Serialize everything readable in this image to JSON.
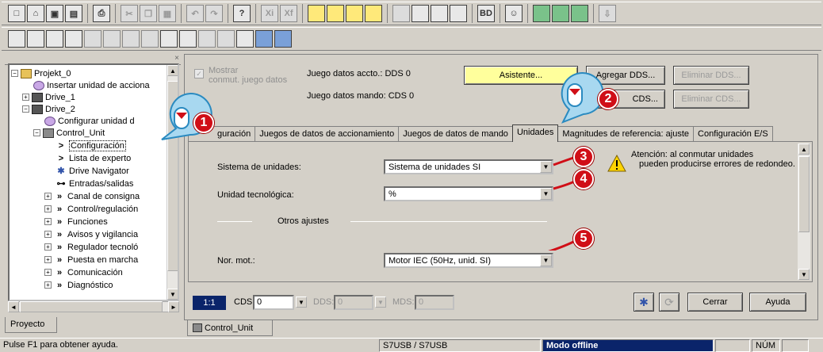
{
  "toolbar1": {
    "groups": [
      [
        "new-icon",
        "open-icon",
        "save-icon",
        "save-all-icon"
      ],
      [
        "print-icon"
      ],
      [
        "cut-icon",
        "copy-icon",
        "paste-icon"
      ],
      [
        "undo-icon",
        "redo-icon"
      ],
      [
        "help-icon"
      ],
      [
        "xi-icon",
        "xf-icon"
      ],
      [
        "view1-icon",
        "view2-icon",
        "view3-icon",
        "view4-icon"
      ],
      [
        "tool1-icon",
        "tool2-icon",
        "tool3-icon",
        "tool4-icon"
      ],
      [
        "bd-icon"
      ],
      [
        "user-icon"
      ],
      [
        "chart1-icon",
        "chart2-icon",
        "chart3-icon"
      ],
      [
        "download-icon"
      ]
    ]
  },
  "toolbar2": {
    "groups": [
      [
        "t1-icon",
        "t2-icon",
        "t3-icon",
        "t4-icon",
        "t5-icon",
        "t6-icon",
        "t7-icon",
        "t8-icon",
        "t9-icon",
        "t10-icon",
        "t11-icon",
        "t12-icon",
        "t13-icon",
        "t14-icon",
        "t15-icon"
      ]
    ]
  },
  "tree": {
    "items": [
      {
        "label": "Projekt_0"
      },
      {
        "label": "Insertar unidad de acciona"
      },
      {
        "label": "Drive_1"
      },
      {
        "label": "Drive_2"
      },
      {
        "label": "Configurar unidad d"
      },
      {
        "label": "Control_Unit"
      },
      {
        "label": "Configuración"
      },
      {
        "label": "Lista de experto"
      },
      {
        "label": "Drive Navigator"
      },
      {
        "label": "Entradas/salidas"
      },
      {
        "label": "Canal de consigna"
      },
      {
        "label": "Control/regulación"
      },
      {
        "label": "Funciones"
      },
      {
        "label": "Avisos y vigilancia"
      },
      {
        "label": "Regulador tecnoló"
      },
      {
        "label": "Puesta en marcha"
      },
      {
        "label": "Comunicación"
      },
      {
        "label": "Diagnóstico"
      }
    ],
    "close_glyph": "×"
  },
  "project_tab": "Proyecto",
  "top": {
    "checkbox_label_1": "Mostrar",
    "checkbox_label_2": "conmut. juego datos",
    "dds_label": "Juego datos accto.: DDS 0",
    "cds_label": "Juego datos mando:  CDS 0",
    "wizard_btn": "Asistente...",
    "add_dds_btn": "Agregar DDS...",
    "del_dds_btn": "Eliminar DDS...",
    "cds_btn": "CDS...",
    "del_cds_btn": "Eliminar CDS..."
  },
  "tabs": [
    {
      "label": "guración"
    },
    {
      "label": "Juegos de datos de accionamiento"
    },
    {
      "label": "Juegos de datos de mando"
    },
    {
      "label": "Unidades"
    },
    {
      "label": "Magnitudes de referencia: ajuste"
    },
    {
      "label": "Configuración E/S"
    }
  ],
  "units": {
    "system_label": "Sistema de unidades:",
    "system_value": "Sistema de unidades SI",
    "tech_label": "Unidad tecnológica:",
    "tech_value": "%",
    "other_settings": "Otros ajustes",
    "motor_label": "Nor. mot.:",
    "motor_value": "Motor IEC (50Hz, unid. SI)",
    "warning_1": "Atención: al conmutar unidades",
    "warning_2": "pueden producirse errores de redondeo."
  },
  "bottom": {
    "ratio": "1:1",
    "cds_label": "CDS:",
    "cds_value": "0",
    "dds_label": "DDS:",
    "dds_value": "0",
    "mds_label": "MDS:",
    "mds_value": "0",
    "close_btn": "Cerrar",
    "help_btn": "Ayuda"
  },
  "bottom_tab": "Control_Unit",
  "status": {
    "hint": "Pulse F1 para obtener ayuda.",
    "interface": "S7USB / S7USB",
    "mode": "Modo offline",
    "num": "NÚM"
  },
  "callouts": [
    "1",
    "2",
    "3",
    "4",
    "5"
  ],
  "colors": {
    "accent_red": "#d00e17",
    "mode_blue": "#0a246a",
    "wizard_yellow": "#ffff9c"
  }
}
